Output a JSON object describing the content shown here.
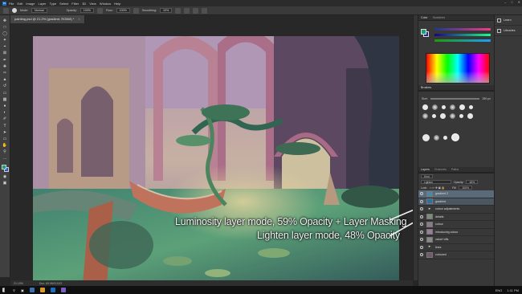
{
  "menu": {
    "logo": "Ps",
    "items": [
      "File",
      "Edit",
      "Image",
      "Layer",
      "Type",
      "Select",
      "Filter",
      "3D",
      "View",
      "Window",
      "Help"
    ]
  },
  "options": {
    "mode_label": "Mode:",
    "mode_value": "Normal",
    "opacity_label": "Opacity:",
    "opacity_value": "100%",
    "flow_label": "Flow:",
    "flow_value": "100%",
    "smoothing_label": "Smoothing:",
    "smoothing_value": "10%"
  },
  "document": {
    "tab_title": "painting.psd @ 21.2% (gradient, RGB/8) *",
    "close": "×",
    "zoom": "21.19%",
    "doc_size": "Doc: 69.9M/3.52G"
  },
  "annotations": {
    "line1": "Luminosity layer mode, 59% Opacity + Layer Masking",
    "line2": "Lighten layer mode, 48% Opacity"
  },
  "color_panel": {
    "tab_color": "Color",
    "tab_swatches": "Swatches",
    "fg_color": "#1b9e7a",
    "bg_color": "#1d2c8a"
  },
  "brushes_panel": {
    "tab": "Brushes",
    "size_label": "Size:",
    "size_value": "250 px"
  },
  "layers_panel": {
    "tabs": [
      "Layers",
      "Channels",
      "Paths"
    ],
    "kind_label": "Kind",
    "blend_mode": "Lighten",
    "opacity_label": "Opacity:",
    "opacity_value": "48%",
    "lock_label": "Lock:",
    "fill_label": "Fill:",
    "fill_value": "100%",
    "layers": [
      {
        "name": "gradient 2",
        "state": "selected",
        "thumb": "#4a88a6"
      },
      {
        "name": "gradient",
        "state": "highlight",
        "thumb": "#2d6f9e"
      },
      {
        "name": "colour adjustments",
        "state": "",
        "thumb": "folder"
      },
      {
        "name": "details",
        "state": "",
        "thumb": "#7c8c78"
      },
      {
        "name": "colour",
        "state": "",
        "thumb": "#8c7a88"
      },
      {
        "name": "introducing colour",
        "state": "",
        "thumb": "#9a7d98"
      },
      {
        "name": "value+offs",
        "state": "",
        "thumb": "#8a8a8a"
      },
      {
        "name": "lines",
        "state": "",
        "thumb": "folder"
      },
      {
        "name": "coloured",
        "state": "",
        "thumb": "#6f5a6a"
      }
    ]
  },
  "side_panel": {
    "items": [
      "Learn",
      "Libraries"
    ]
  },
  "taskbar": {
    "lang": "ENG",
    "time": "1:11 PM"
  }
}
